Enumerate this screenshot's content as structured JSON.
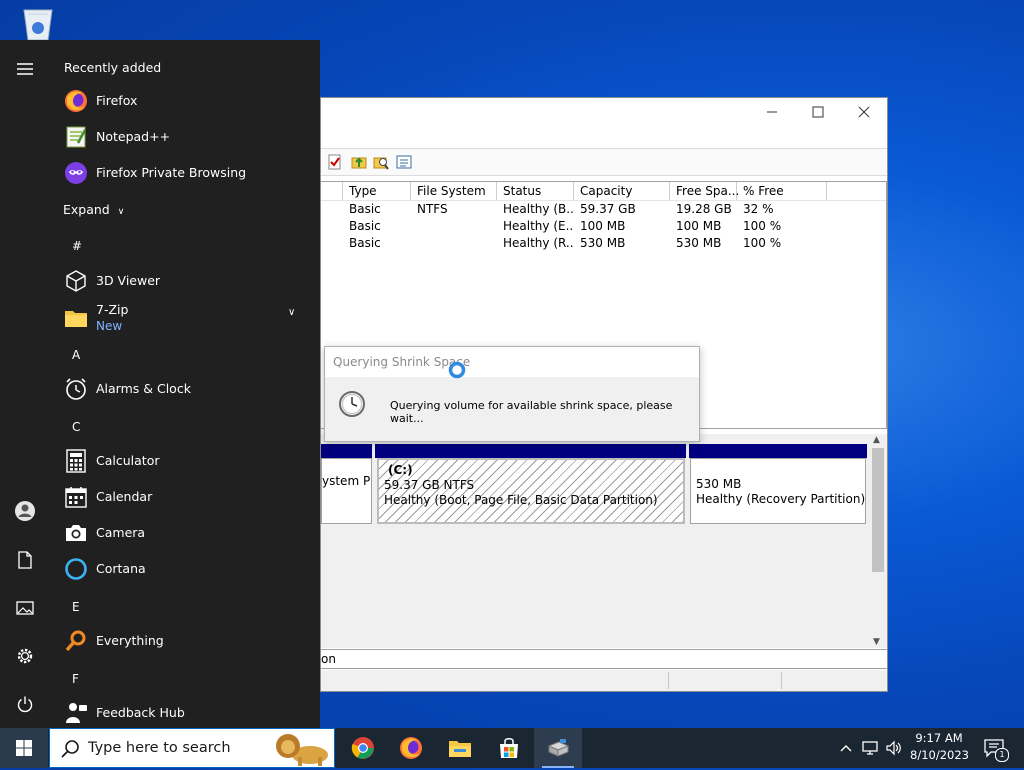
{
  "start_menu": {
    "recently_added_label": "Recently added",
    "expand_label": "Expand",
    "recent": [
      {
        "label": "Firefox",
        "icon": "firefox-icon"
      },
      {
        "label": "Notepad++",
        "icon": "notepadpp-icon"
      },
      {
        "label": "Firefox Private Browsing",
        "icon": "firefox-private-icon"
      }
    ],
    "letters": {
      "hash": "#",
      "a": "A",
      "c": "C",
      "e": "E",
      "f": "F"
    },
    "apps": {
      "viewer3d": "3D Viewer",
      "sevenzip": "7-Zip",
      "sevenzip_badge": "New",
      "alarms": "Alarms & Clock",
      "calculator": "Calculator",
      "calendar": "Calendar",
      "camera": "Camera",
      "cortana": "Cortana",
      "everything": "Everything",
      "feedback": "Feedback Hub"
    }
  },
  "disk_management": {
    "columns": [
      "Type",
      "File System",
      "Status",
      "Capacity",
      "Free Spa...",
      "% Free"
    ],
    "volumes": [
      {
        "type": "Basic",
        "fs": "NTFS",
        "status": "Healthy (B...",
        "capacity": "59.37 GB",
        "free": "19.28 GB",
        "pct": "32 %"
      },
      {
        "type": "Basic",
        "fs": "",
        "status": "Healthy (E...",
        "capacity": "100 MB",
        "free": "100 MB",
        "pct": "100 %"
      },
      {
        "type": "Basic",
        "fs": "",
        "status": "Healthy (R...",
        "capacity": "530 MB",
        "free": "530 MB",
        "pct": "100 %"
      }
    ],
    "partitions": {
      "left_label": "ystem P",
      "c_title": "(C:)",
      "c_size": "59.37 GB NTFS",
      "c_status": "Healthy (Boot, Page File, Basic Data Partition)",
      "recovery_size": "530 MB",
      "recovery_status": "Healthy (Recovery Partition)"
    },
    "legend_text": "on"
  },
  "query_dialog": {
    "title": "Querying Shrink Space",
    "message": "Querying volume for available shrink space, please wait..."
  },
  "taskbar": {
    "search_placeholder": "Type here to search",
    "time": "9:17 AM",
    "date": "8/10/2023",
    "notification_count": "1"
  },
  "colors": {
    "start_bg": "#202020",
    "taskbar_bg": "#1b2633",
    "partition_bar": "#000080",
    "accent": "#0067c0"
  }
}
